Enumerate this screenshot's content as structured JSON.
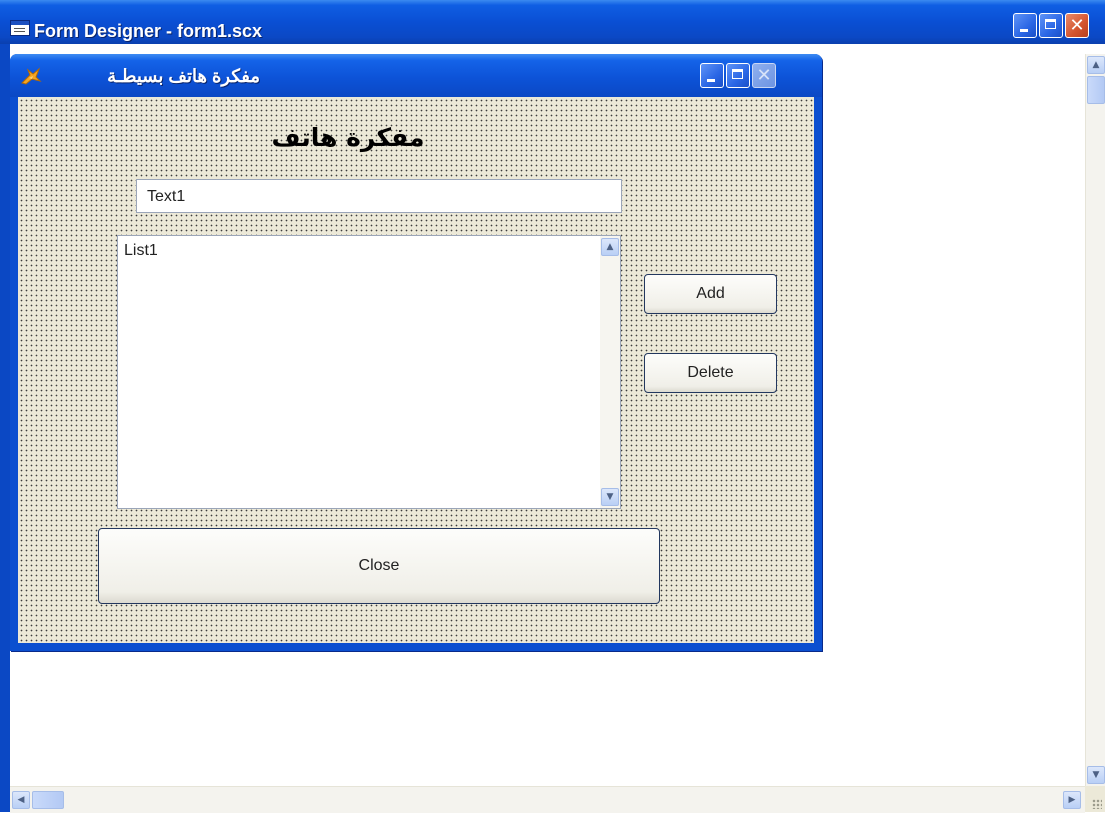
{
  "outer_window": {
    "title": "Form Designer - form1.scx",
    "minimize_glyph": "",
    "close_glyph": "✕"
  },
  "form_window": {
    "title": "مفكرة هاتف بسيطـة",
    "close_glyph": "✕"
  },
  "form": {
    "label_title": "مفكرة هاتف",
    "text1_value": "Text1",
    "list1_caption": "List1",
    "add_label": "Add",
    "delete_label": "Delete",
    "close_label": "Close"
  },
  "scroll": {
    "up": "▲",
    "down": "▼",
    "left": "◀",
    "right": "▶"
  },
  "colors": {
    "titlebar": "#0b48c4",
    "form_background": "#ece9d8",
    "grid_dots": "#3c3c3c",
    "close_button": "#d3542e"
  }
}
